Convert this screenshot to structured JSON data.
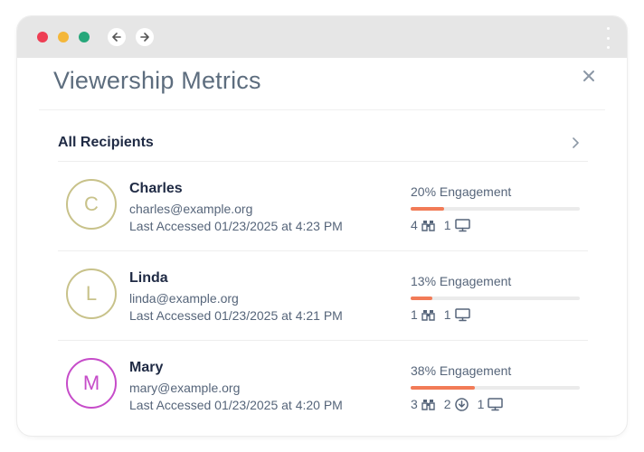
{
  "dialog": {
    "title": "Viewership Metrics",
    "section_label": "All Recipients"
  },
  "colors": {
    "accent": "#f27b57",
    "avatar_olive": "#c8c28a",
    "avatar_magenta": "#c64cc9"
  },
  "recipients": [
    {
      "initial": "C",
      "name": "Charles",
      "email": "charles@example.org",
      "last_accessed": "Last Accessed 01/23/2025 at 4:23 PM",
      "engagement_label": "20% Engagement",
      "engagement": 0.2,
      "views": "4",
      "downloads": null,
      "devices": "1",
      "avatar_color": "#c8c28a"
    },
    {
      "initial": "L",
      "name": "Linda",
      "email": "linda@example.org",
      "last_accessed": "Last Accessed 01/23/2025 at 4:21 PM",
      "engagement_label": "13% Engagement",
      "engagement": 0.13,
      "views": "1",
      "downloads": null,
      "devices": "1",
      "avatar_color": "#c8c28a"
    },
    {
      "initial": "M",
      "name": "Mary",
      "email": "mary@example.org",
      "last_accessed": "Last Accessed 01/23/2025 at 4:20 PM",
      "engagement_label": "38% Engagement",
      "engagement": 0.38,
      "views": "3",
      "downloads": "2",
      "devices": "1",
      "avatar_color": "#c64cc9"
    }
  ]
}
